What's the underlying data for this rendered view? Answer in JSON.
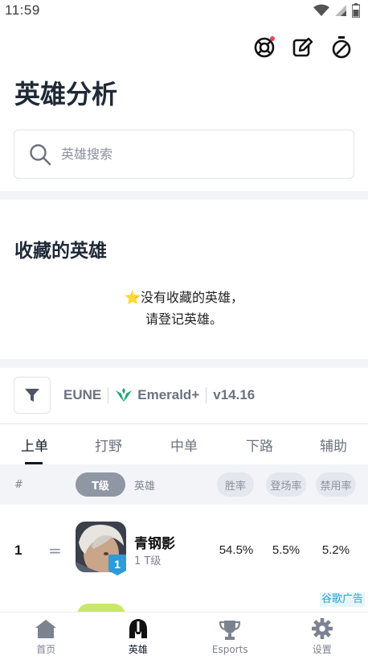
{
  "status_bar": {
    "time": "11:59"
  },
  "header": {
    "actions": [
      {
        "icon": "support-icon",
        "has_badge": true
      },
      {
        "icon": "edit-icon"
      },
      {
        "icon": "timer-icon"
      }
    ]
  },
  "page": {
    "title": "英雄分析"
  },
  "search": {
    "placeholder": "英雄搜索",
    "value": ""
  },
  "favorites": {
    "title": "收藏的英雄",
    "empty_line1": "⭐没有收藏的英雄，",
    "empty_line2": "请登记英雄。"
  },
  "filter": {
    "region": "EUNE",
    "tier": "Emerald+",
    "version": "v14.16",
    "tier_color": "#1fa67a"
  },
  "tabs": [
    {
      "label": "上单",
      "active": true
    },
    {
      "label": "打野",
      "active": false
    },
    {
      "label": "中单",
      "active": false
    },
    {
      "label": "下路",
      "active": false
    },
    {
      "label": "辅助",
      "active": false
    }
  ],
  "table": {
    "columns": {
      "rank": "#",
      "tier": "T级",
      "champion": "英雄",
      "win_rate": "胜率",
      "pick_rate": "登场率",
      "ban_rate": "禁用率"
    },
    "rows": [
      {
        "rank": "1",
        "trend": "=",
        "name": "青钢影",
        "tier_label": "1 T级",
        "tier_number": "1",
        "win_rate": "54.5%",
        "pick_rate": "5.5%",
        "ban_rate": "5.2%"
      }
    ]
  },
  "ad": {
    "label": "谷歌广告"
  },
  "bottom_nav": [
    {
      "label": "首页",
      "icon": "home-icon",
      "active": false
    },
    {
      "label": "英雄",
      "icon": "champion-helmet-icon",
      "active": true
    },
    {
      "label": "Esports",
      "icon": "trophy-icon",
      "active": false
    },
    {
      "label": "设置",
      "icon": "gear-icon",
      "active": false
    }
  ],
  "colors": {
    "accent": "#111827",
    "tier_badge": "#2f9ad8",
    "band": "#f3f4f8",
    "ad": "#27a3cf"
  }
}
